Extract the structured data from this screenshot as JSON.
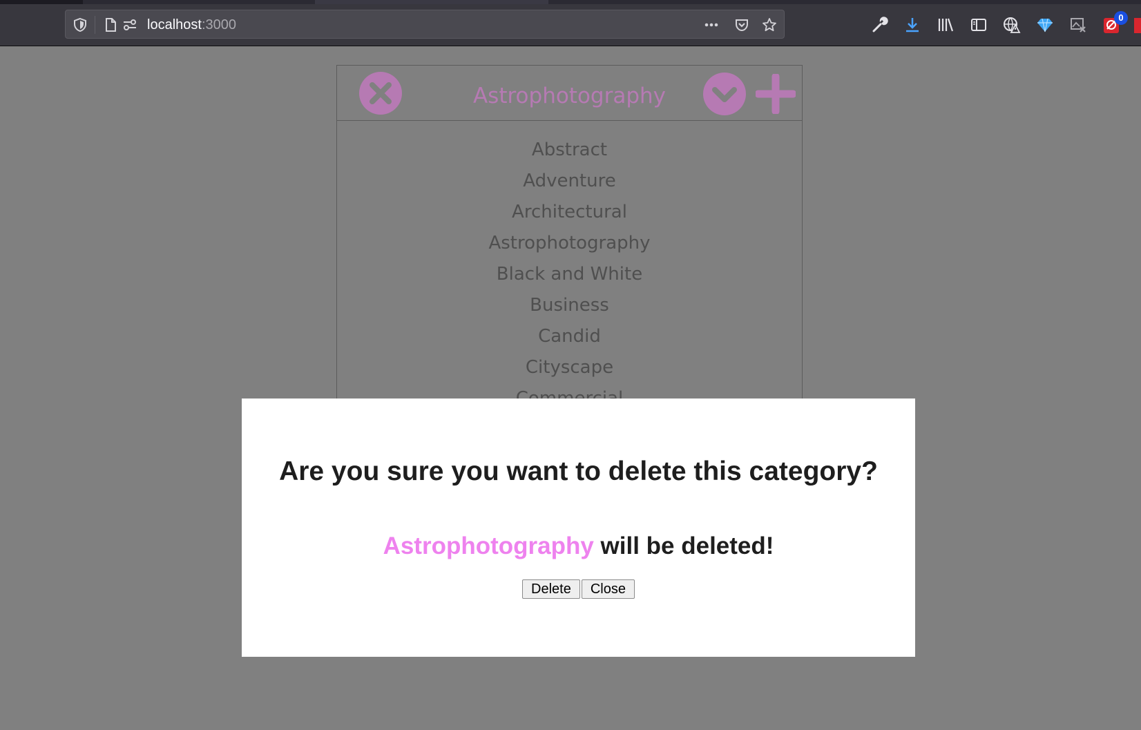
{
  "browser": {
    "url_host": "localhost",
    "url_port": ":3000",
    "extension_badge": "0",
    "icons": {
      "tracking": "shield-icon",
      "page": "page-icon",
      "permissions": "permissions-icon",
      "page_actions": "more-icon",
      "pocket": "pocket-icon",
      "bookmark": "star-icon",
      "devtools": "wrench-icon",
      "downloads": "download-icon",
      "library": "library-icon",
      "sidebar": "sidebar-icon",
      "ext1": "warning-globe-icon",
      "ext2": "diamond-icon",
      "ext3": "image-cross-icon",
      "ext4": "ublock-icon"
    }
  },
  "panel": {
    "title": "Astrophotography",
    "accent_color": "#b67ab3",
    "categories": [
      "Abstract",
      "Adventure",
      "Architectural",
      "Astrophotography",
      "Black and White",
      "Business",
      "Candid",
      "Cityscape",
      "Commercial"
    ]
  },
  "modal": {
    "question": "Are you sure you want to delete this category?",
    "category_name": "Astrophotography",
    "message_suffix": " will be deleted!",
    "highlight_color": "#ee82ee",
    "delete_label": "Delete",
    "close_label": "Close"
  }
}
